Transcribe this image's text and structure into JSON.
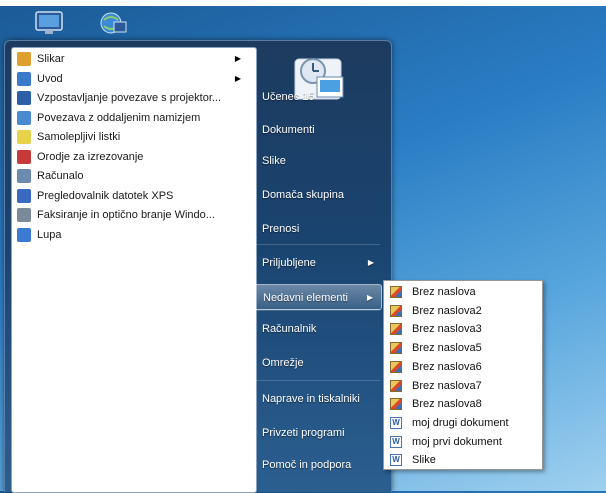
{
  "programs": [
    {
      "label": "Slikar",
      "icon": "paint-icon",
      "submenu": true,
      "color": "#e0a030"
    },
    {
      "label": "Uvod",
      "icon": "windows-icon",
      "submenu": true,
      "color": "#3a7ac8"
    },
    {
      "label": "Vzpostavljanje povezave s projektor...",
      "icon": "projector-icon",
      "submenu": false,
      "color": "#2d5fa8"
    },
    {
      "label": "Povezava z oddaljenim namizjem",
      "icon": "remote-desktop-icon",
      "submenu": false,
      "color": "#4a8ad0"
    },
    {
      "label": "Samolepljivi listki",
      "icon": "sticky-notes-icon",
      "submenu": false,
      "color": "#e8d24a"
    },
    {
      "label": "Orodje za izrezovanje",
      "icon": "snipping-tool-icon",
      "submenu": false,
      "color": "#c83a3a"
    },
    {
      "label": "Računalo",
      "icon": "calculator-icon",
      "submenu": false,
      "color": "#6a8ab0"
    },
    {
      "label": "Pregledovalnik datotek XPS",
      "icon": "xps-viewer-icon",
      "submenu": false,
      "color": "#3a6ac0"
    },
    {
      "label": "Faksiranje in optično branje Windo...",
      "icon": "fax-scan-icon",
      "submenu": false,
      "color": "#7a8a9a"
    },
    {
      "label": "Lupa",
      "icon": "magnifier-icon",
      "submenu": false,
      "color": "#3a7ad0"
    }
  ],
  "right_items": [
    {
      "label": "Učenec 15",
      "submenu": false,
      "active": false
    },
    {
      "label": "Dokumenti",
      "submenu": false,
      "active": false
    },
    {
      "label": "Slike",
      "submenu": false,
      "active": false
    },
    {
      "label": "Domača skupina",
      "submenu": false,
      "active": false
    },
    {
      "label": "Prenosi",
      "submenu": false,
      "active": false
    },
    {
      "label": "Priljubljene",
      "submenu": true,
      "active": false
    },
    {
      "label": "Nedavni elementi",
      "submenu": true,
      "active": true
    },
    {
      "label": "Računalnik",
      "submenu": false,
      "active": false
    },
    {
      "label": "Omrežje",
      "submenu": false,
      "active": false
    },
    {
      "label": "Naprave in tiskalniki",
      "submenu": false,
      "active": false
    },
    {
      "label": "Privzeti programi",
      "submenu": false,
      "active": false
    },
    {
      "label": "Pomoč in podpora",
      "submenu": false,
      "active": false
    }
  ],
  "recent_items": [
    {
      "label": "Brez naslova",
      "type": "paint"
    },
    {
      "label": "Brez naslova2",
      "type": "paint"
    },
    {
      "label": "Brez naslova3",
      "type": "paint"
    },
    {
      "label": "Brez naslova5",
      "type": "paint"
    },
    {
      "label": "Brez naslova6",
      "type": "paint"
    },
    {
      "label": "Brez naslova7",
      "type": "paint"
    },
    {
      "label": "Brez naslova8",
      "type": "paint"
    },
    {
      "label": "moj drugi dokument",
      "type": "word"
    },
    {
      "label": "moj prvi dokument",
      "type": "word"
    },
    {
      "label": "Slike",
      "type": "word"
    }
  ],
  "word_icon_letter": "W"
}
